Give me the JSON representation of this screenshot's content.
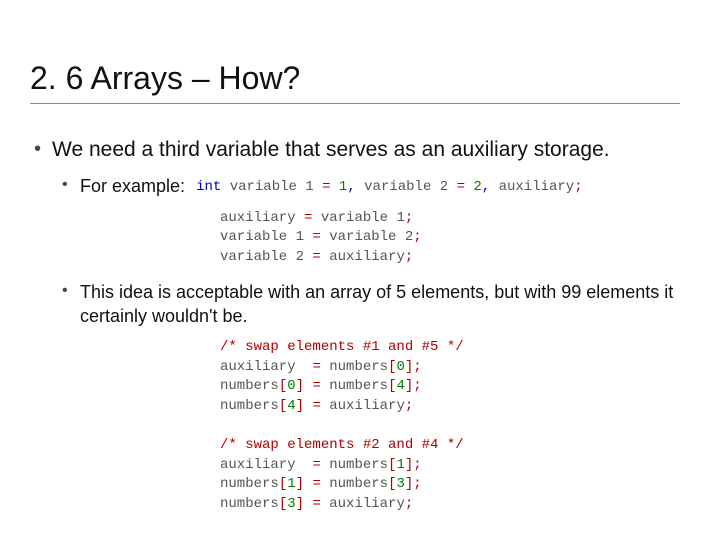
{
  "title": "2. 6 Arrays – How?",
  "bullet1": "We need a third variable that serves as an auxiliary storage.",
  "bullet2_label": "For example:",
  "code1": {
    "kw_int": "int",
    "v1": "variable 1",
    "eq": "=",
    "n1": "1",
    "comma": ",",
    "v2": "variable 2",
    "n2": "2",
    "aux": "auxiliary",
    "semi": ";"
  },
  "code2": {
    "l1_lhs": "auxiliary",
    "l1_eq": "=",
    "l1_rhs": "variable 1",
    "l1_semi": ";",
    "l2_lhs": "variable 1",
    "l2_eq": "=",
    "l2_rhs": "variable 2",
    "l2_semi": ";",
    "l3_lhs": "variable 2",
    "l3_eq": "=",
    "l3_rhs": "auxiliary",
    "l3_semi": ";"
  },
  "bullet3": "This idea is acceptable with an array of 5 elements, but with 99 elements it certainly wouldn't be.",
  "code3": {
    "cmt1": "/* swap elements #1 and #5 */",
    "a1_lhs": "auxiliary",
    "a1_eq": "=",
    "a1_arr": "numbers",
    "a1_lb": "[",
    "a1_idx": "0",
    "a1_rb": "]",
    "a1_semi": ";",
    "a2_lhs": "numbers",
    "a2_lb": "[",
    "a2_idx": "0",
    "a2_rb": "]",
    "a2_eq": "=",
    "a2_rarr": "numbers",
    "a2_rlb": "[",
    "a2_ridx": "4",
    "a2_rrb": "]",
    "a2_semi": ";",
    "a3_lhs": "numbers",
    "a3_lb": "[",
    "a3_idx": "4",
    "a3_rb": "]",
    "a3_eq": "=",
    "a3_rhs": "auxiliary",
    "a3_semi": ";",
    "cmt2": "/* swap elements #2 and #4 */",
    "b1_lhs": "auxiliary",
    "b1_eq": "=",
    "b1_arr": "numbers",
    "b1_lb": "[",
    "b1_idx": "1",
    "b1_rb": "]",
    "b1_semi": ";",
    "b2_lhs": "numbers",
    "b2_lb": "[",
    "b2_idx": "1",
    "b2_rb": "]",
    "b2_eq": "=",
    "b2_rarr": "numbers",
    "b2_rlb": "[",
    "b2_ridx": "3",
    "b2_rrb": "]",
    "b2_semi": ";",
    "b3_lhs": "numbers",
    "b3_lb": "[",
    "b3_idx": "3",
    "b3_rb": "]",
    "b3_eq": "=",
    "b3_rhs": "auxiliary",
    "b3_semi": ";"
  }
}
